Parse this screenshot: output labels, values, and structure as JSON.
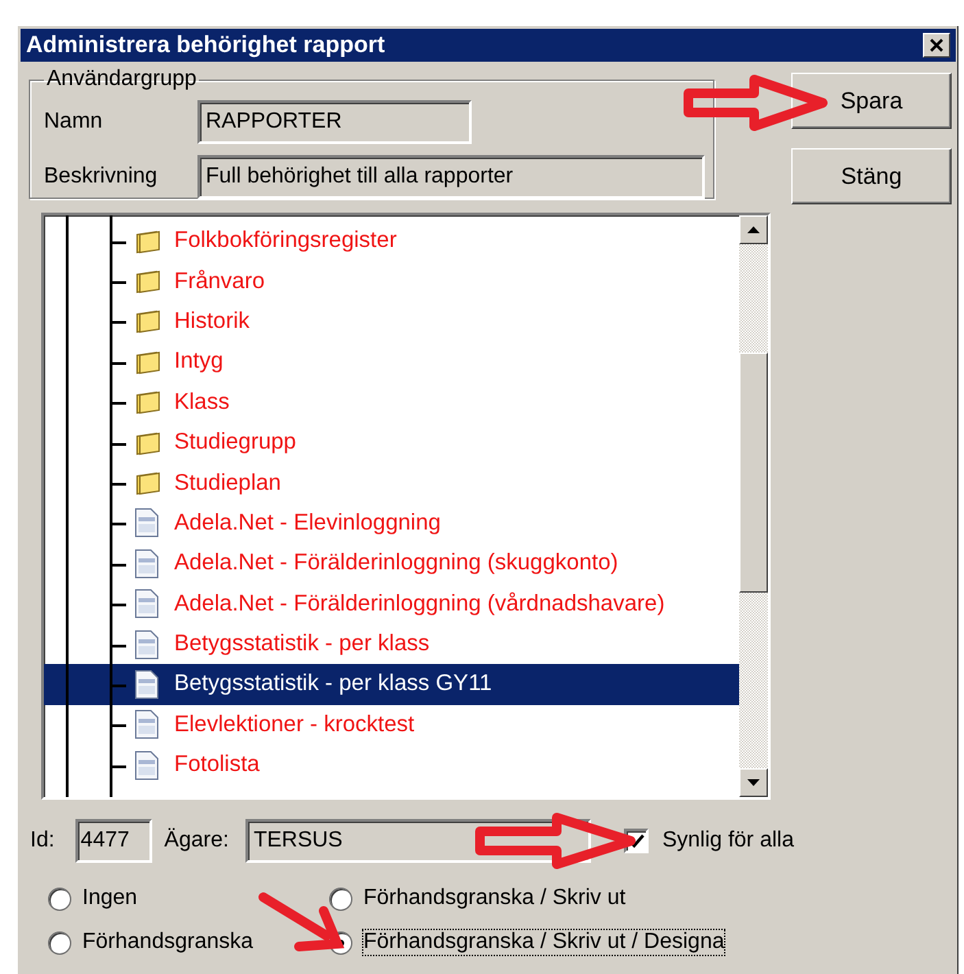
{
  "window": {
    "title": "Administrera behörighet rapport"
  },
  "user_group": {
    "legend": "Användargrupp",
    "name_label": "Namn",
    "name": "RAPPORTER",
    "description_label": "Beskrivning",
    "description": "Full behörighet till alla rapporter"
  },
  "buttons": [
    {
      "label": "Spara"
    },
    {
      "label": "Stäng"
    }
  ],
  "tree": {
    "items": [
      {
        "label": "Folkbokföringsregister",
        "kind": "folder",
        "selected": false
      },
      {
        "label": "Frånvaro",
        "kind": "folder",
        "selected": false
      },
      {
        "label": "Historik",
        "kind": "folder",
        "selected": false
      },
      {
        "label": "Intyg",
        "kind": "folder",
        "selected": false
      },
      {
        "label": "Klass",
        "kind": "folder",
        "selected": false
      },
      {
        "label": "Studiegrupp",
        "kind": "folder",
        "selected": false
      },
      {
        "label": "Studieplan",
        "kind": "folder",
        "selected": false
      },
      {
        "label": "Adela.Net - Elevinloggning",
        "kind": "report",
        "selected": false
      },
      {
        "label": "Adela.Net - Förälderinloggning (skuggkonto)",
        "kind": "report",
        "selected": false
      },
      {
        "label": "Adela.Net - Förälderinloggning (vårdnadshavare)",
        "kind": "report",
        "selected": false
      },
      {
        "label": "Betygsstatistik - per klass",
        "kind": "report",
        "selected": false
      },
      {
        "label": "Betygsstatistik - per klass GY11",
        "kind": "report",
        "selected": true
      },
      {
        "label": "Elevlektioner - krocktest",
        "kind": "report",
        "selected": false
      },
      {
        "label": "Fotolista",
        "kind": "report",
        "selected": false
      }
    ]
  },
  "details": {
    "id_label": "Id:",
    "id": "4477",
    "owner_label": "Ägare:",
    "owner": "TERSUS",
    "visible": {
      "label": "Synlig för alla",
      "checked": true
    }
  },
  "permissions": [
    {
      "label": "Ingen",
      "selected": false
    },
    {
      "label": "Förhandsgranska",
      "selected": false
    },
    {
      "label": "Förhandsgranska / Skriv ut",
      "selected": false
    },
    {
      "label": "Förhandsgranska / Skriv ut / Designa",
      "selected": true
    }
  ]
}
